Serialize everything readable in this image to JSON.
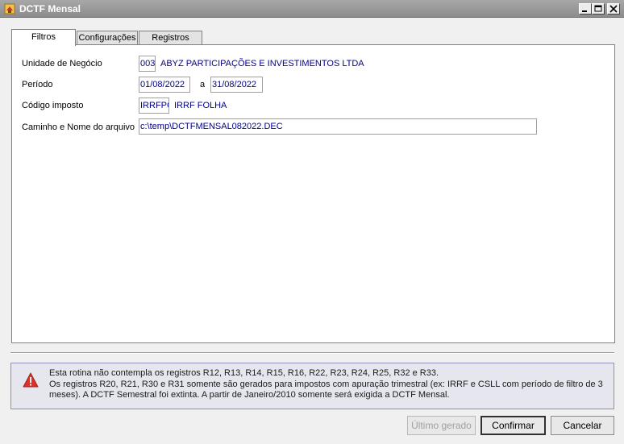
{
  "window": {
    "title": "DCTF Mensal",
    "icon": "app-icon",
    "controls": [
      "minimize-icon",
      "maximize-icon",
      "close-icon"
    ]
  },
  "tabs": [
    {
      "label": "Filtros",
      "active": true
    },
    {
      "label": "Configurações",
      "active": false
    },
    {
      "label": "Registros",
      "active": false
    }
  ],
  "filters": {
    "unidade": {
      "label": "Unidade de Negócio",
      "code": "003",
      "description": "ABYZ PARTICIPAÇÕES E INVESTIMENTOS LTDA"
    },
    "periodo": {
      "label": "Período",
      "start": "01/08/2022",
      "separator": "a",
      "end": "31/08/2022"
    },
    "codigo": {
      "label": "Código imposto",
      "code": "IRRFPG",
      "description": "IRRF FOLHA"
    },
    "caminho": {
      "label": "Caminho e Nome do arquivo",
      "value": "c:\\temp\\DCTFMENSAL082022.DEC"
    }
  },
  "info": {
    "icon": "warning-icon",
    "line1": "Esta rotina não contempla os registros R12, R13, R14, R15, R16, R22, R23, R24, R25, R32 e R33.",
    "line2": "Os registros R20, R21, R30 e R31 somente são gerados para impostos com apuração trimestral (ex: IRRF e CSLL com período de filtro de 3 meses). A DCTF Semestral foi extinta. A partir de Janeiro/2010 somente será exigida a DCTF Mensal."
  },
  "buttons": {
    "ultimo": "Último gerado",
    "confirmar": "Confirmar",
    "cancelar": "Cancelar"
  },
  "colors": {
    "field_text": "#00008b",
    "info_background": "#e6e6ee",
    "warning": "#d9342b"
  }
}
